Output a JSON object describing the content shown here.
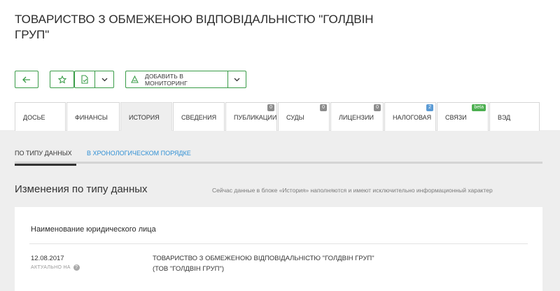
{
  "company": {
    "title": "ТОВАРИСТВО З ОБМЕЖЕНОЮ ВІДПОВІДАЛЬНІСТЮ \"ГОЛДВІН ГРУП\""
  },
  "toolbar": {
    "monitoring_label": "ДОБАВИТЬ В МОНИТОРИНГ",
    "accent_color": "#3a9c48"
  },
  "tabs": [
    {
      "label": "ДОСЬЕ"
    },
    {
      "label": "ФИНАНСЫ"
    },
    {
      "label": "ИСТОРИЯ",
      "active": true
    },
    {
      "label": "СВЕДЕНИЯ"
    },
    {
      "label": "ПУБЛИКАЦИИ",
      "badge": "0"
    },
    {
      "label": "СУДЫ",
      "badge": "0"
    },
    {
      "label": "ЛИЦЕНЗИИ",
      "badge": "0"
    },
    {
      "label": "НАЛОГОВАЯ",
      "badge": "2"
    },
    {
      "label": "СВЯЗИ",
      "badge": "beta"
    },
    {
      "label": "ВЭД"
    }
  ],
  "subtabs": {
    "by_type": "ПО ТИПУ ДАННЫХ",
    "chronological": "В ХРОНОЛОГИЧЕСКОМ ПОРЯДКЕ"
  },
  "section": {
    "title": "Изменения по типу данных",
    "note": "Сейчас данные в блоке «История» наполняются и имеют исключительно информационный характер"
  },
  "card": {
    "title": "Наименование юридического лица",
    "date": "12.08.2017",
    "actual_label": "АКТУАЛЬНО НА",
    "value_line1": "ТОВАРИСТВО З ОБМЕЖЕНОЮ ВІДПОВІДАЛЬНІСТЮ \"ГОЛДВІН ГРУП\"",
    "value_line2": "(ТОВ \"ГОЛДВІН ГРУП\")"
  }
}
